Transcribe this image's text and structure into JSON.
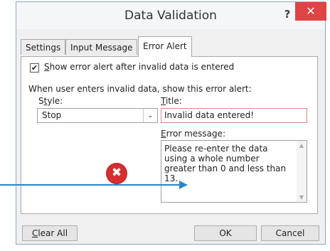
{
  "dialog": {
    "title": "Data Validation",
    "help_glyph": "?",
    "close_glyph": "✕"
  },
  "tabs": [
    {
      "label": "Settings"
    },
    {
      "label": "Input Message"
    },
    {
      "label": "Error Alert",
      "active": true
    }
  ],
  "error_alert": {
    "show_alert_checked": true,
    "checkmark": "✔",
    "show_alert_label_first": "S",
    "show_alert_label_rest": "how error alert after invalid data is entered",
    "instruction": "When user enters invalid data, show this error alert:",
    "style_label_first": "S",
    "style_label_mid": "t",
    "style_label_rest": "yle:",
    "style_value": "Stop",
    "title_label_first": "T",
    "title_label_rest": "itle:",
    "title_value": "Invalid data entered!",
    "message_label_first": "E",
    "message_label_rest": "rror message:",
    "message_value": "Please re-enter the data using a whole number greater than 0 and less than 13.",
    "stop_icon_glyph": "✖"
  },
  "buttons": {
    "clear_all_first": "C",
    "clear_all_rest": "lear All",
    "ok": "OK",
    "cancel": "Cancel"
  },
  "colors": {
    "close_button": "#e04343",
    "stop_icon": "#d62f2f",
    "arrow": "#2b86c8"
  },
  "icons": {
    "stop": "stop-error-icon",
    "close": "close-icon",
    "help": "help-icon",
    "dropdown": "chevron-down-icon"
  }
}
